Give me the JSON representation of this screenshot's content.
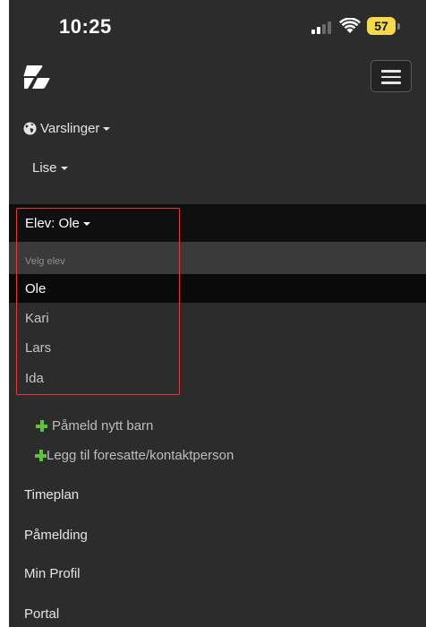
{
  "status_bar": {
    "time": "10:25",
    "battery": "57",
    "signal_icon": "cellular-signal-icon",
    "wifi_icon": "wifi-icon"
  },
  "navbar": {
    "logo_icon": "brand-logo-icon",
    "menu_icon": "hamburger-menu-icon"
  },
  "menu": {
    "notifications_label": "Varslinger",
    "user_label": "Lise",
    "student_prefix": "Elev:",
    "student_selected": "Ole",
    "dropdown_header": "Velg elev",
    "students": [
      "Ole",
      "Kari",
      "Lars",
      "Ida"
    ],
    "register_child": "Påmeld nytt barn",
    "add_guardian": "Legg til foresatte/kontaktperson",
    "links": [
      "Timeplan",
      "Påmelding",
      "Min Profil",
      "Portal"
    ]
  },
  "colors": {
    "background": "#2c2c2c",
    "highlight": "#0f0f0f",
    "accent_green": "#5ec43c",
    "annotation_red": "#e63a3a",
    "battery_yellow": "#f5d94a"
  }
}
